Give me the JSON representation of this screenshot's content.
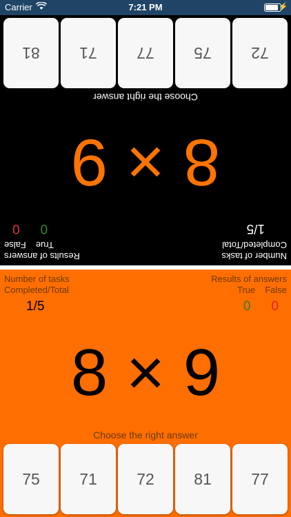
{
  "status_bar": {
    "carrier": "Carrier",
    "time": "7:21 PM",
    "battery_level": 0.95
  },
  "top_player": {
    "answers": [
      "72",
      "75",
      "77",
      "71",
      "81"
    ],
    "choose_label": "Choose the right answer",
    "question": "8 × 9",
    "tasks_label": "Number of tasks",
    "tasks_sub_label": "Completed/Total",
    "tasks_value": "1/5",
    "results_label": "Results of answers",
    "true_label": "True",
    "false_label": "False",
    "true_value": "0",
    "false_value": "0"
  },
  "bottom_player": {
    "answers": [
      "75",
      "71",
      "72",
      "81",
      "77"
    ],
    "choose_label": "Choose the right answer",
    "question": "8 × 9",
    "tasks_label": "Number of tasks",
    "tasks_sub_label": "Completed/Total",
    "tasks_value": "1/5",
    "results_label": "Results of answers",
    "true_label": "True",
    "false_label": "False",
    "true_value": "0",
    "false_value": "0"
  },
  "colors": {
    "top_bg": "#000000",
    "bottom_bg": "#ff6e00",
    "accent": "#ff7400"
  }
}
